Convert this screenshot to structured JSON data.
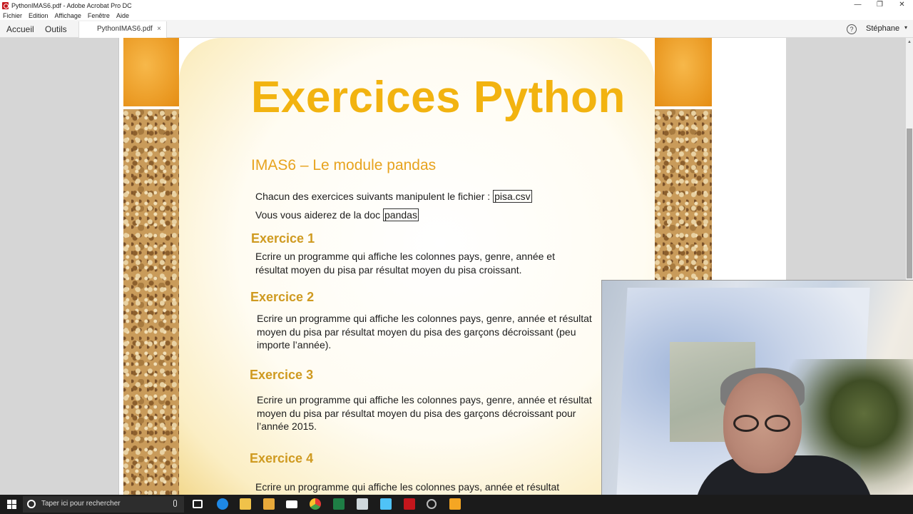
{
  "window": {
    "title": "PythonIMAS6.pdf - Adobe Acrobat Pro DC",
    "controls": {
      "minimize": "—",
      "restore": "❐",
      "close": "✕"
    }
  },
  "menu": [
    "Fichier",
    "Edition",
    "Affichage",
    "Fenêtre",
    "Aide"
  ],
  "tabs": {
    "home": "Accueil",
    "tools": "Outils",
    "document": "PythonIMAS6.pdf",
    "close": "×",
    "help": "?",
    "user": "Stéphane",
    "user_caret": "▾"
  },
  "document": {
    "title": "Exercices Python",
    "subtitle": "IMAS6 – Le module pandas",
    "intro1_text": "Chacun des exercices suivants manipulent le fichier : ",
    "intro1_link": "pisa.csv",
    "intro2_text": "Vous vous aiderez de la doc ",
    "intro2_link": "pandas",
    "exercises": [
      {
        "heading": "Exercice 1",
        "lines": [
          "Ecrire un programme qui affiche les colonnes pays, genre, année et",
          "résultat moyen du pisa par résultat moyen du pisa croissant."
        ]
      },
      {
        "heading": "Exercice 2",
        "lines": [
          "Ecrire un programme qui affiche les colonnes pays, genre, année et résultat",
          "moyen du pisa par résultat moyen du pisa des garçons décroissant (peu",
          "importe l’année)."
        ]
      },
      {
        "heading": "Exercice 3",
        "lines": [
          "Ecrire un programme qui affiche les colonnes pays, genre, année et résultat",
          "moyen du pisa par résultat moyen du pisa des garçons décroissant pour",
          "l’année 2015."
        ]
      },
      {
        "heading": "Exercice 4",
        "lines": [
          "Ecrire un programme qui affiche les colonnes pays,  année et résultat"
        ]
      }
    ]
  },
  "taskbar": {
    "search_placeholder": "Taper ici pour rechercher",
    "icons": [
      "task-view",
      "edge",
      "file-explorer",
      "store",
      "mail",
      "chrome",
      "excel",
      "notepad",
      "app",
      "acrobat",
      "media",
      "video"
    ]
  },
  "colors": {
    "title_accent": "#f2b310",
    "heading_accent": "#cf9a20",
    "subtitle_accent": "#e7a31f"
  }
}
